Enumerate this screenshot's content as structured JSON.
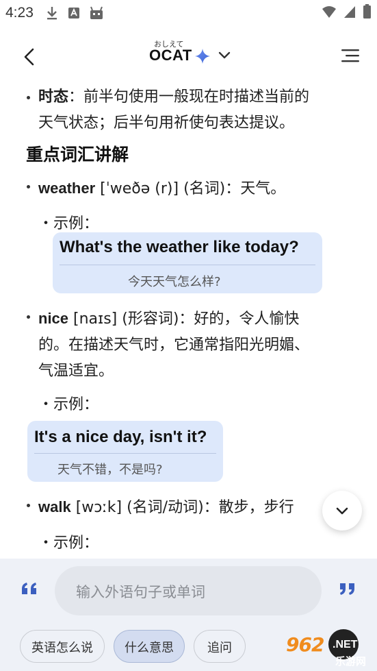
{
  "status_bar": {
    "time": "4:23"
  },
  "header": {
    "title_ruby": "おしえて",
    "title": "OCAT"
  },
  "content": {
    "tense_label": "时态",
    "tense_line1": "：前半句使用一般现在时描述当前的",
    "tense_line2": "天气状态；后半句用祈使句表达提议。",
    "vocab_heading": "重点词汇讲解",
    "words": [
      {
        "word": "weather",
        "rest": " [ˈweðə (r)] (名词)：天气。",
        "example_label": "示例：",
        "example_en": "What's the weather like today?",
        "example_zh": "今天天气怎么样?"
      },
      {
        "word": "nice",
        "rest": " [naɪs] (形容词)：好的，令人愉快",
        "rest_line2": "的。在描述天气时，它通常指阳光明媚、",
        "rest_line3": "气温适宜。",
        "example_label": "示例：",
        "example_en": "It's a nice day, isn't it?",
        "example_zh": "天气不错，不是吗?"
      },
      {
        "word": "walk",
        "rest": " [wɔːk] (名词/动词)：散步，步行",
        "example_label": "示例："
      }
    ]
  },
  "input": {
    "placeholder": "输入外语句子或单词"
  },
  "chips": [
    {
      "label": "英语怎么说",
      "selected": false
    },
    {
      "label": "什么意思",
      "selected": true
    },
    {
      "label": "追问",
      "selected": false
    }
  ],
  "watermark": {
    "brand": "962",
    "suffix": ".NET",
    "sub": "乐游网"
  },
  "colors": {
    "card_bg": "#dde8fb",
    "bottom_bg": "#eef1f7",
    "accent_blue": "#3b6fd8",
    "watermark_orange": "#f08c1e"
  }
}
